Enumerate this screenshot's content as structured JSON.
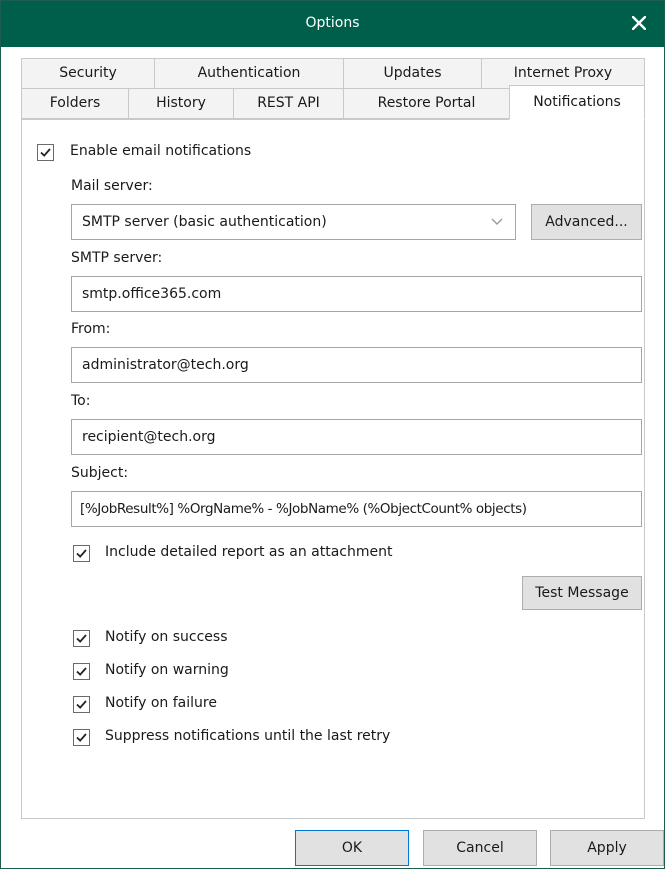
{
  "window": {
    "title": "Options"
  },
  "tabs": {
    "row1": [
      "Security",
      "Authentication",
      "Updates",
      "Internet Proxy"
    ],
    "row2": [
      "Folders",
      "History",
      "REST API",
      "Restore Portal",
      "Notifications"
    ],
    "active": "Notifications"
  },
  "notifications": {
    "enable_email": {
      "label": "Enable email notifications",
      "checked": true
    },
    "mail_server": {
      "label": "Mail server:",
      "selected": "SMTP server (basic authentication)",
      "advanced_label": "Advanced..."
    },
    "smtp_server": {
      "label": "SMTP server:",
      "value": "smtp.office365.com"
    },
    "from": {
      "label": "From:",
      "value": "administrator@tech.org"
    },
    "to": {
      "label": "To:",
      "value": "recipient@tech.org"
    },
    "subject": {
      "label": "Subject:",
      "value": "[%JobResult%] %OrgName% - %JobName% (%ObjectCount% objects)"
    },
    "include_report": {
      "label": "Include detailed report as an attachment",
      "checked": true
    },
    "test_message_label": "Test Message",
    "notify_success": {
      "label": "Notify on success",
      "checked": true
    },
    "notify_warning": {
      "label": "Notify on warning",
      "checked": true
    },
    "notify_failure": {
      "label": "Notify on failure",
      "checked": true
    },
    "suppress": {
      "label": "Suppress notifications until the last retry",
      "checked": true
    }
  },
  "footer": {
    "ok": "OK",
    "cancel": "Cancel",
    "apply": "Apply"
  },
  "colors": {
    "titlebar": "#005f4b",
    "accent": "#0078d7"
  }
}
